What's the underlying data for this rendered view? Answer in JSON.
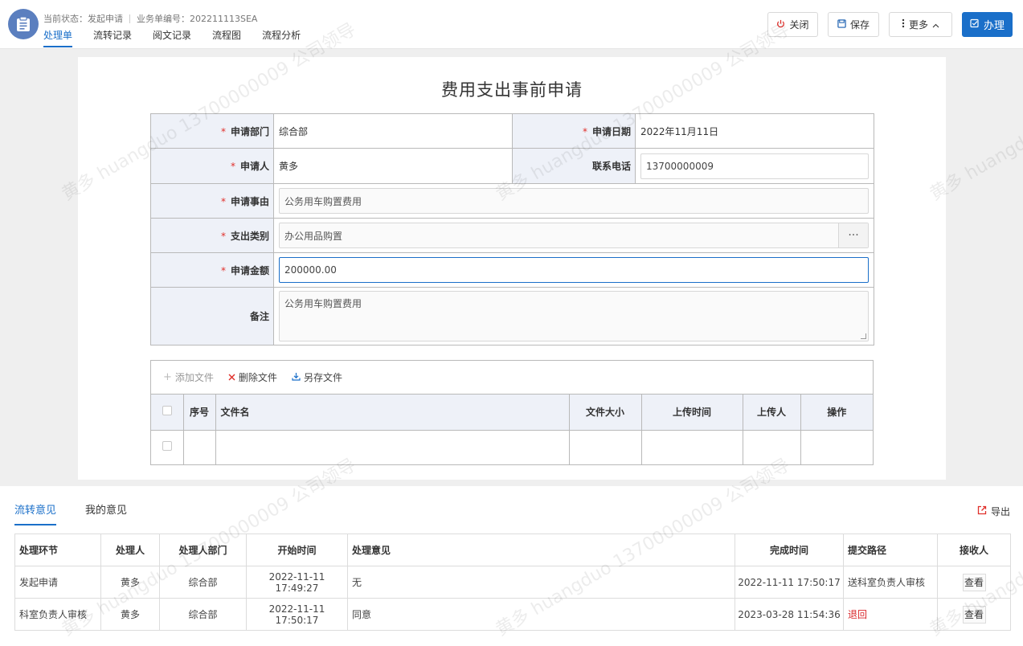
{
  "header": {
    "status_label": "当前状态：",
    "status_value": "发起申请",
    "bizno_label": "业务单编号：",
    "bizno_value": "202211113SEA",
    "tabs": [
      {
        "label": "处理单",
        "active": true
      },
      {
        "label": "流转记录"
      },
      {
        "label": "阅文记录"
      },
      {
        "label": "流程图"
      },
      {
        "label": "流程分析"
      }
    ],
    "buttons": {
      "close": "关闭",
      "save": "保存",
      "more": "更多",
      "handle": "办理"
    }
  },
  "form": {
    "title": "费用支出事前申请",
    "fields": {
      "dept_label": "申请部门",
      "dept_value": "综合部",
      "date_label": "申请日期",
      "date_value": "2022年11月11日",
      "applicant_label": "申请人",
      "applicant_value": "黄多",
      "phone_label": "联系电话",
      "phone_value": "13700000009",
      "reason_label": "申请事由",
      "reason_value": "公务用车购置费用",
      "category_label": "支出类别",
      "category_value": "办公用品购置",
      "amount_label": "申请金额",
      "amount_value": "200000.00",
      "remark_label": "备注",
      "remark_value": "公务用车购置费用"
    },
    "required_mark": "*"
  },
  "files": {
    "toolbar": {
      "add": "添加文件",
      "delete": "删除文件",
      "save_as": "另存文件"
    },
    "columns": [
      "序号",
      "文件名",
      "文件大小",
      "上传时间",
      "上传人",
      "操作"
    ]
  },
  "opinions": {
    "tabs": [
      {
        "label": "流转意见",
        "active": true
      },
      {
        "label": "我的意见"
      }
    ],
    "export_label": "导出",
    "columns": [
      "处理环节",
      "处理人",
      "处理人部门",
      "开始时间",
      "处理意见",
      "完成时间",
      "提交路径",
      "接收人"
    ],
    "rows": [
      {
        "step": "发起申请",
        "handler": "黄多",
        "dept": "综合部",
        "start": "2022-11-11 17:49:27",
        "opinion": "无",
        "finish": "2022-11-11 17:50:17",
        "path": "送科室负责人审核",
        "path_color": "normal",
        "receiver": "查看"
      },
      {
        "step": "科室负责人审核",
        "handler": "黄多",
        "dept": "综合部",
        "start": "2022-11-11 17:50:17",
        "opinion": "同意",
        "finish": "2023-03-28 11:54:36",
        "path": "退回",
        "path_color": "#d9262a",
        "receiver": "查看"
      }
    ]
  },
  "watermark": "黄多 huangduo 13700000009 公司领导",
  "colors": {
    "accent": "#1a6fc9",
    "danger": "#d9262a",
    "label_bg": "#eef1f8"
  }
}
